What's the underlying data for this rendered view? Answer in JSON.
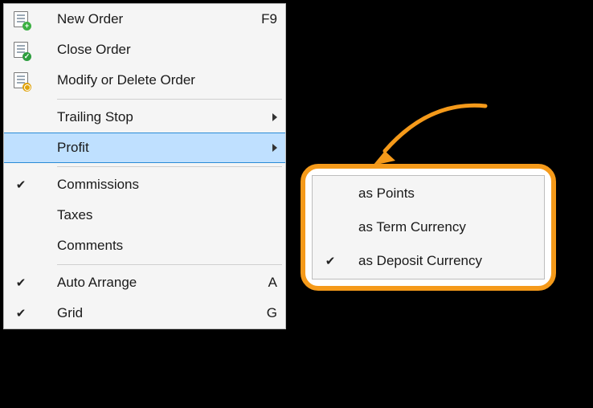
{
  "mainMenu": {
    "items": [
      {
        "label": "New Order",
        "shortcut": "F9",
        "icon": "doc-plus"
      },
      {
        "label": "Close Order",
        "icon": "doc-check"
      },
      {
        "label": "Modify or Delete Order",
        "icon": "doc-gear"
      },
      {
        "label": "Trailing Stop",
        "submenu": true
      },
      {
        "label": "Profit",
        "submenu": true,
        "highlight": true
      },
      {
        "label": "Commissions",
        "checked": true
      },
      {
        "label": "Taxes"
      },
      {
        "label": "Comments"
      },
      {
        "label": "Auto Arrange",
        "shortcut": "A",
        "checked": true
      },
      {
        "label": "Grid",
        "shortcut": "G",
        "checked": true
      }
    ]
  },
  "submenu": {
    "items": [
      {
        "label": "as Points"
      },
      {
        "label": "as Term Currency"
      },
      {
        "label": "as Deposit Currency",
        "checked": true
      }
    ]
  }
}
